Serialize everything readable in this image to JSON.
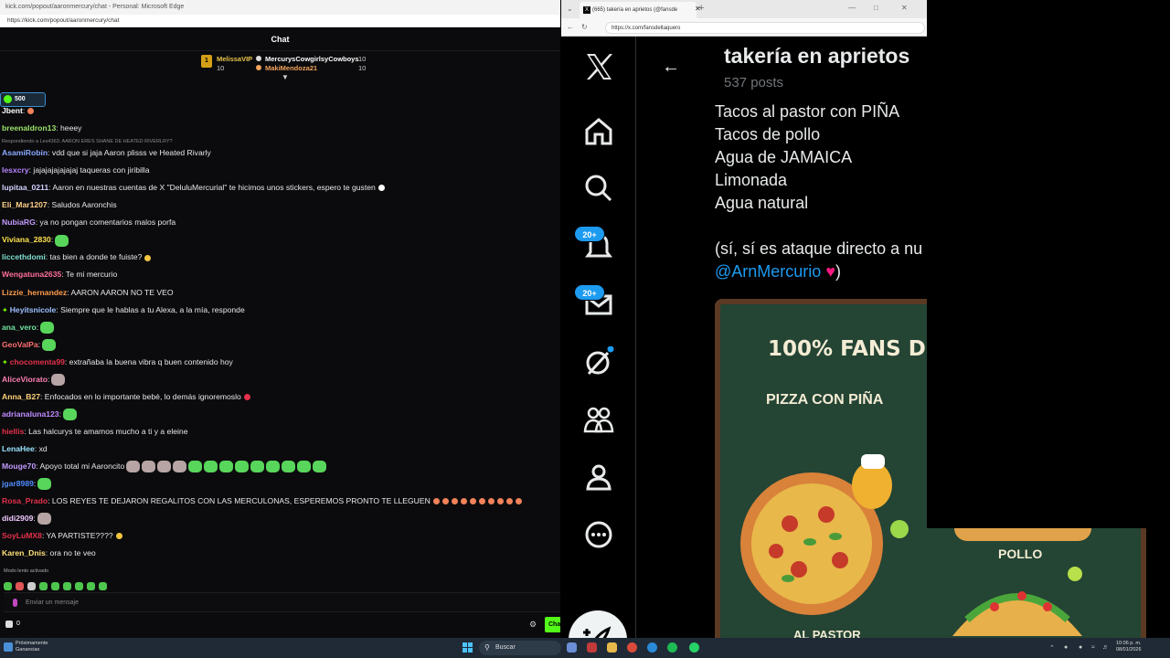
{
  "left_window": {
    "title": "kick.com/popout/aaronmercury/chat - Personal: Microsoft Edge",
    "url": "https://kick.com/popout/aaronmercury/chat",
    "chat_title": "Chat",
    "leaderboard": [
      {
        "rank": "1",
        "name": "MelissaVIP",
        "value": "10",
        "color": "#e8c54a"
      },
      {
        "name": "MercurysCowgirlsyCowboys",
        "value": "10",
        "color": "#ffffff"
      },
      {
        "name": "MakiMendoza21",
        "value": "10",
        "color": "#f2a35c"
      }
    ],
    "count_pill": "500",
    "reply_note": "Respondiendo a Les4363: AARON ERES SHANE DE HEATED RIVERLRY?",
    "messages": [
      {
        "user": "Jbent",
        "text": "",
        "color": "#ffffff"
      },
      {
        "user": "breenaldron13",
        "text": " heeey",
        "color": "#9be36b"
      },
      {
        "user": "AsamiRobin",
        "text": " vdd que si jaja Aaron plisss ve Heated Rivarly",
        "color": "#8aa9ff"
      },
      {
        "user": "lesxcry",
        "text": " jajajajajajajaj taqueras con jiribilla",
        "color": "#b884ff"
      },
      {
        "user": "lupitaa_0211",
        "text": " Aaron en nuestras cuentas de X \"DeluluMercurial\" te hicimos unos stickers, espero te gusten",
        "color": "#d0d0ff"
      },
      {
        "user": "Eli_Mar1207",
        "text": " Saludos Aaronchis",
        "color": "#ffd08a"
      },
      {
        "user": "NubiaRG",
        "text": " ya no pongan comentarios malos porfa",
        "color": "#c49cff"
      },
      {
        "user": "Viviana_2830",
        "text": "",
        "color": "#ffe34d"
      },
      {
        "user": "liccethdomi",
        "text": " tas bien a donde te fuiste?",
        "color": "#7fe0d0"
      },
      {
        "user": "Wengatuna2635",
        "text": " Te mi mercurio",
        "color": "#ff6f9a"
      },
      {
        "user": "Lizzie_hernandez",
        "text": " AARON AARON NO TE VEO",
        "color": "#ff9d4d"
      },
      {
        "user": "Heyitsnicole",
        "text": " Siempre que le hablas a tu Alexa, a la mía, responde",
        "color": "#9cc0ff"
      },
      {
        "user": "ana_vero",
        "text": "",
        "color": "#6fe3a0"
      },
      {
        "user": "GeoValPa",
        "text": "",
        "color": "#ff6f6f"
      },
      {
        "user": "chocomenta99",
        "text": " extrañaba la buena vibra q buen contenido hoy",
        "color": "#e6314b"
      },
      {
        "user": "AliceViorato",
        "text": "",
        "color": "#ff7fb4"
      },
      {
        "user": "Anna_B27",
        "text": " Enfocados en lo importante bebé, lo demás ignoremoslo",
        "color": "#ffd27a"
      },
      {
        "user": "adrianaluna123",
        "text": "",
        "color": "#c08cff"
      },
      {
        "user": "hiellis",
        "text": " Las halcurys te amamos mucho a ti y a eleine",
        "color": "#e6314b"
      },
      {
        "user": "LenaHee",
        "text": " xd",
        "color": "#9be3ff"
      },
      {
        "user": "Mouge70",
        "text": " Apoyo total mi Aaroncito",
        "color": "#c49cff"
      },
      {
        "user": "jgar8989",
        "text": "",
        "color": "#4f8cff"
      },
      {
        "user": "Rosa_Prado",
        "text": " LOS REYES TE DEJARON REGALITOS CON LAS MERCULONAS, ESPEREMOS PRONTO TE LLEGUEN",
        "color": "#e6314b"
      },
      {
        "user": "didi2909",
        "text": "",
        "color": "#f0c8ff"
      },
      {
        "user": "SoyLuMX8",
        "text": " YA PARTISTE????",
        "color": "#e6314b"
      },
      {
        "user": "Karen_Dnis",
        "text": " ora no te veo",
        "color": "#ffe07a"
      }
    ],
    "slow_mode": "Modo lento activado",
    "input_placeholder": "Enviar un mensaje",
    "viewer_count": "0",
    "send_label": "Cha"
  },
  "right_window": {
    "tab_title": "(665) takería en aprietos (@fansde",
    "url": "https://x.com/fansdeltaquero",
    "profile_name": "takería en aprietos",
    "posts_count": "537 posts",
    "lines": [
      "Tacos al pastor con PIÑA",
      "Tacos de pollo",
      "Agua de JAMAICA",
      "Limonada",
      "Agua natural"
    ],
    "closing_text": "(sí, sí es ataque directo a nu",
    "mention": "@ArnMercurio",
    "closing_paren": ")",
    "notif_badge": "20+",
    "msg_badge": "20+",
    "image_title": "100% FANS D",
    "image_sub": "PIZZA CON PIÑA",
    "image_bottom": "AL PASTOR",
    "pollo_label": "POLLO"
  },
  "taskbar": {
    "weather_line1": "Próximamente",
    "weather_line2": "Ganancias",
    "search": "Buscar",
    "time": "10:06 p. m.",
    "date": "08/01/2026"
  },
  "colors": {
    "kick_green": "#53fc18",
    "x_blue": "#1d9bf0",
    "x_pink": "#f91880"
  }
}
